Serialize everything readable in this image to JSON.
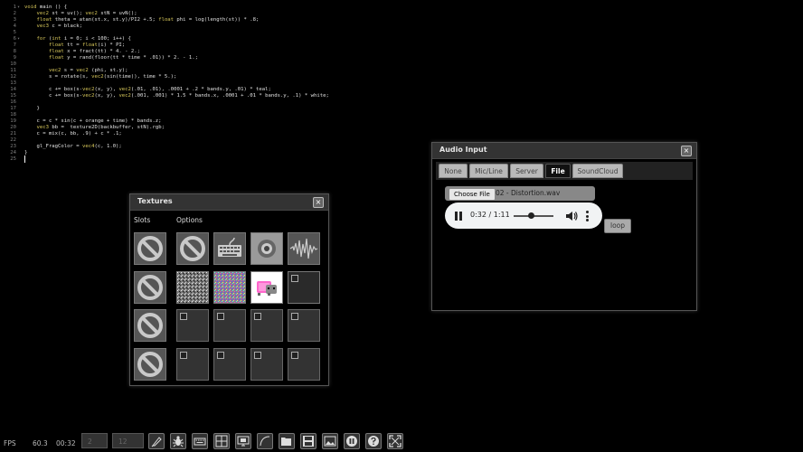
{
  "editor": {
    "lines": [
      {
        "n": "1",
        "fold": true,
        "code": "void main () {"
      },
      {
        "n": "2",
        "code": "    vec2 st = uv(); vec2 stN = uvN();"
      },
      {
        "n": "3",
        "code": "    float theta = atan(st.x, st.y)/PI2 +.5; float phi = log(length(st)) * .8;"
      },
      {
        "n": "4",
        "code": "    vec3 c = black;"
      },
      {
        "n": "5",
        "code": ""
      },
      {
        "n": "6",
        "fold": true,
        "code": "    for (int i = 0; i < 100; i++) {"
      },
      {
        "n": "7",
        "code": "        float tt = float(i) * PI;"
      },
      {
        "n": "8",
        "code": "        float x = fract(tt) * 4. - 2.;"
      },
      {
        "n": "9",
        "code": "        float y = rand(floor(tt * time * .01)) * 2. - 1.;"
      },
      {
        "n": "10",
        "code": ""
      },
      {
        "n": "11",
        "code": "        vec2 s = vec2 (phi, st.y);"
      },
      {
        "n": "12",
        "code": "        s = rotate(s, vec2(sin(time)), time * 5.);"
      },
      {
        "n": "13",
        "code": ""
      },
      {
        "n": "14",
        "code": "        c += box(s-vec2(x, y), vec2(.01, .01), .0001 + .2 * bands.y, .01) * teal;"
      },
      {
        "n": "15",
        "code": "        c += box(s-vec2(x, y), vec2(.001, .001) * 1.5 * bands.x, .0001 + .01 * bands.y, .1) * white;"
      },
      {
        "n": "16",
        "code": ""
      },
      {
        "n": "17",
        "code": "    }"
      },
      {
        "n": "18",
        "code": ""
      },
      {
        "n": "19",
        "code": "    c = c * sin(c + orange + time) * bands.z;"
      },
      {
        "n": "20",
        "code": "    vec3 bb =  texture2D(backbuffer, stN).rgb;"
      },
      {
        "n": "21",
        "code": "    c = mix(c, bb, .9) + c * .1;"
      },
      {
        "n": "22",
        "code": ""
      },
      {
        "n": "23",
        "code": "    gl_FragColor = vec4(c, 1.0);"
      },
      {
        "n": "24",
        "code": "}"
      },
      {
        "n": "25",
        "code": ""
      }
    ]
  },
  "textures": {
    "title": "Textures",
    "slots_label": "Slots",
    "options_label": "Options",
    "close": "×"
  },
  "audio": {
    "title": "Audio Input",
    "close": "×",
    "tabs": [
      "None",
      "Mic/Line",
      "Server",
      "File",
      "SoundCloud"
    ],
    "active_tab": "File",
    "choose_file": "Choose File",
    "file_name": "02 - Distortion.wav",
    "time": "0:32 / 1:11",
    "progress": 0.45,
    "loop": "loop"
  },
  "footer": {
    "fps_label": "FPS",
    "fps_value": "60.3",
    "time_value": "00:32",
    "box1": "2",
    "box2": "12"
  },
  "colors": {
    "accent": "#d8c85a",
    "panel_header": "#333333"
  }
}
